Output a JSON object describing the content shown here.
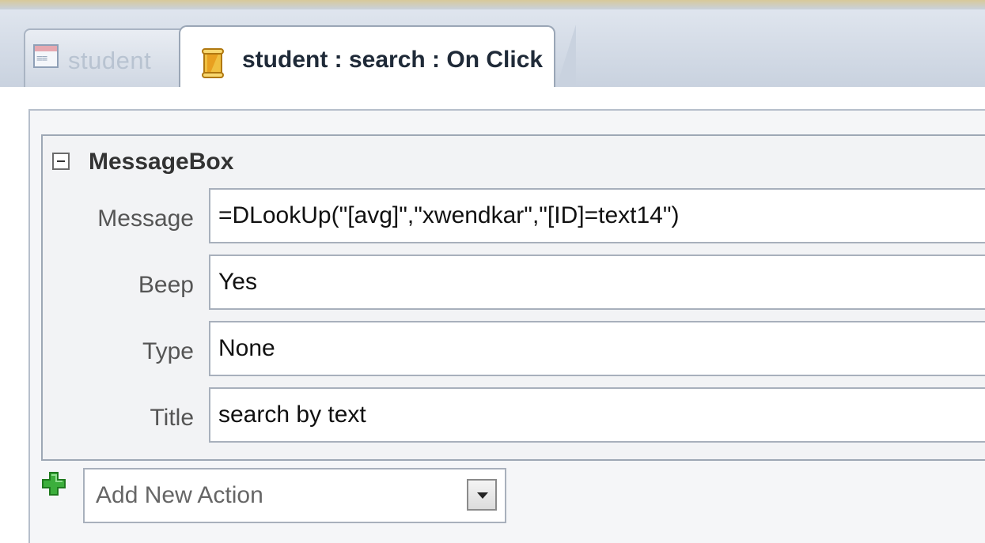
{
  "tabs": [
    {
      "label": "student",
      "icon": "form-icon",
      "active": false
    },
    {
      "label": "student : search : On Click",
      "icon": "macro-icon",
      "active": true
    }
  ],
  "action": {
    "name": "MessageBox",
    "arguments": [
      {
        "label": "Message",
        "value": "=DLookUp(\"[avg]\",\"xwendkar\",\"[ID]=text14\")"
      },
      {
        "label": "Beep",
        "value": "Yes"
      },
      {
        "label": "Type",
        "value": "None"
      },
      {
        "label": "Title",
        "value": "search by text"
      }
    ]
  },
  "add_action": {
    "placeholder": "Add New Action",
    "icon": "plus-icon"
  },
  "colors": {
    "tab_bar": "#c9d2df",
    "plus_green": "#3cae3c",
    "macro_icon": "#e0a020"
  }
}
